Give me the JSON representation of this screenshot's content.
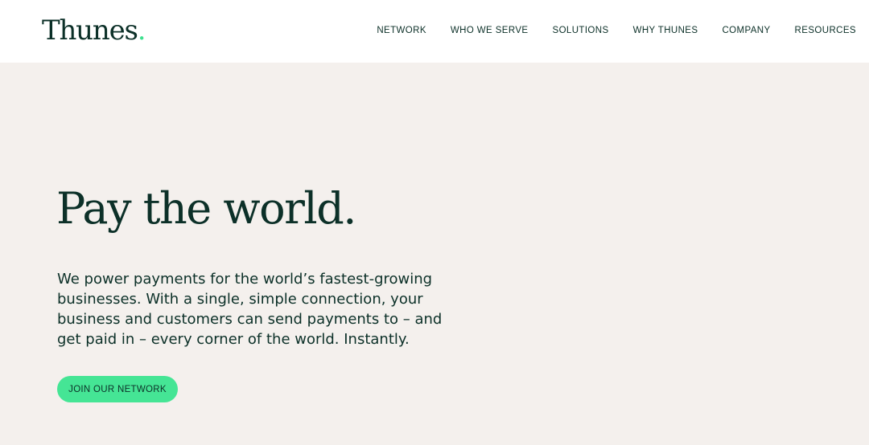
{
  "header": {
    "logo_text": "Thunes",
    "logo_dot": ".",
    "nav": [
      {
        "label": "NETWORK"
      },
      {
        "label": "WHO WE SERVE"
      },
      {
        "label": "SOLUTIONS"
      },
      {
        "label": "WHY THUNES"
      },
      {
        "label": "COMPANY"
      },
      {
        "label": "RESOURCES"
      }
    ]
  },
  "hero": {
    "title": "Pay the world.",
    "body": "We power payments for the world’s fastest-growing businesses. With a single, simple connection, your business and customers can send payments to – and get paid in – every corner of the world. Instantly.",
    "cta_label": "JOIN OUR NETWORK"
  },
  "colors": {
    "brand_dark": "#0c3028",
    "accent_green": "#45e595",
    "background": "#f4f0ed",
    "header_background": "#ffffff"
  }
}
